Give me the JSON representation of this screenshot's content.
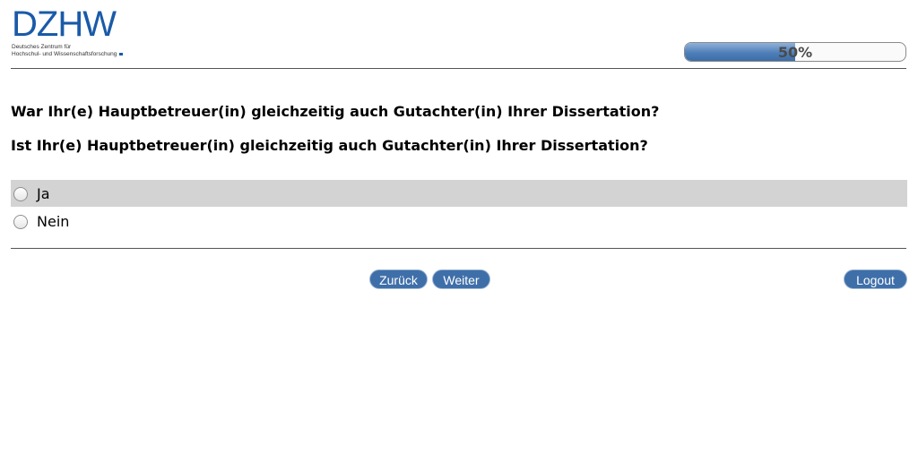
{
  "header": {
    "logo_text": "DZHW",
    "logo_subtitle_line1": "Deutsches Zentrum für",
    "logo_subtitle_line2": "Hochschul- und Wissenschaftsforschung",
    "progress_label": "50%",
    "progress_value": 0.5
  },
  "questions": [
    "War Ihr(e) Hauptbetreuer(in) gleichzeitig auch Gutachter(in) Ihrer Dissertation?",
    "Ist Ihr(e) Hauptbetreuer(in) gleichzeitig auch Gutachter(in) Ihrer Dissertation?"
  ],
  "options": [
    {
      "label": "Ja",
      "selected": false
    },
    {
      "label": "Nein",
      "selected": false
    }
  ],
  "buttons": {
    "back": "Zurück",
    "next": "Weiter",
    "logout": "Logout"
  },
  "colors": {
    "brand": "#1a5aa8",
    "button": "#3f6fa9",
    "highlight_row": "#d3d3d3"
  }
}
